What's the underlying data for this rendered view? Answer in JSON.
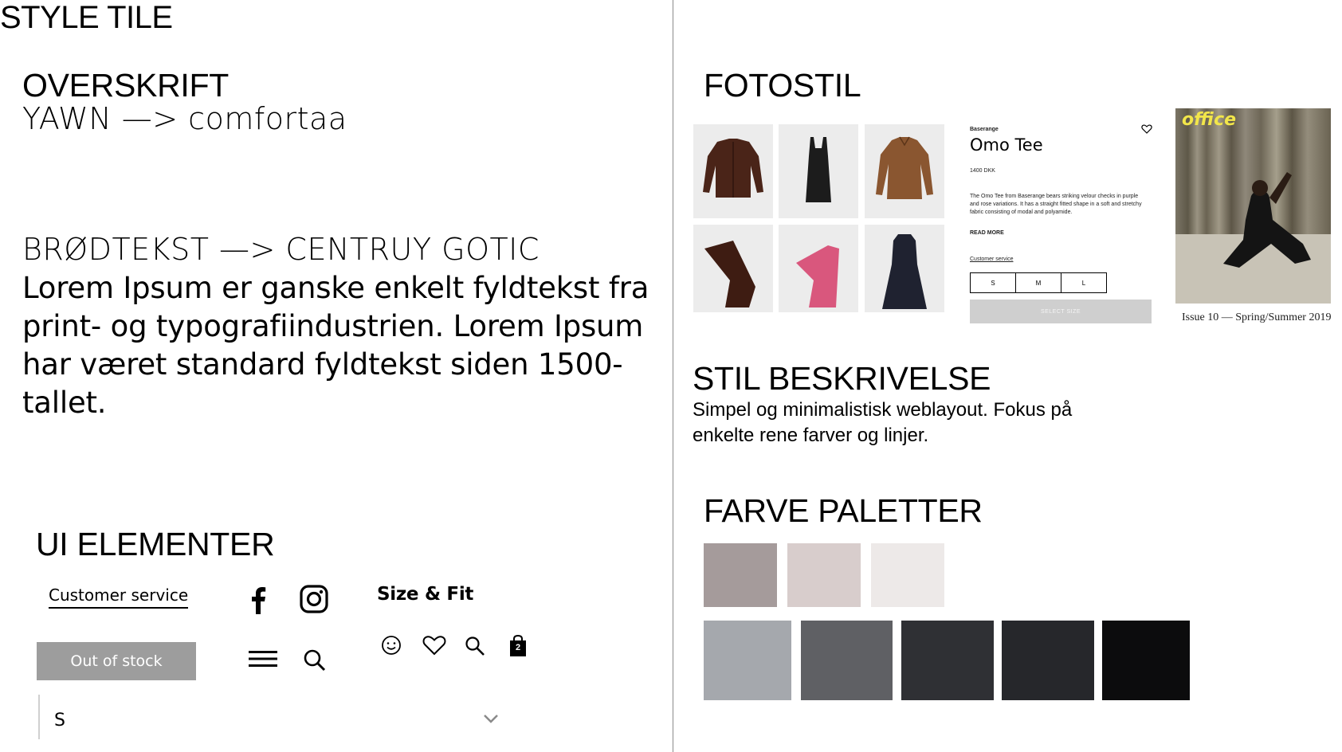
{
  "page_title": "STYLE TILE",
  "headline_section": {
    "heading": "OVERSKRIFT",
    "font_note": "YAWN —> comfortaa"
  },
  "body_section": {
    "heading": "BRØDTEKST —> CENTRUY GOTIC",
    "sample_text": "Lorem Ipsum er ganske enkelt fyldtekst fra print- og typografiindustrien. Lorem Ipsum har været standard fyldtekst siden 1500-tallet."
  },
  "ui_section": {
    "heading": "UI ELEMENTER",
    "customer_service_link": "Customer service",
    "out_of_stock_button": "Out of stock",
    "size_fit_label": "Size & Fit",
    "select_value": "S",
    "bag_count": "2",
    "icons": [
      "facebook-icon",
      "instagram-icon",
      "menu-icon",
      "search-icon",
      "smiley-icon",
      "heart-icon",
      "search-icon",
      "bag-icon",
      "chevron-down-icon"
    ]
  },
  "photo_section": {
    "heading": "FOTOSTIL",
    "product_card": {
      "brand": "Baserange",
      "name": "Omo Tee",
      "price": "1400 DKK",
      "description": "The Omo Tee from Baserange bears striking velour checks in purple and rose variations. It has a straight fitted shape in a soft and stretchy fabric consisting of modal and polyamide.",
      "read_more": "READ MORE",
      "customer_service": "Customer service",
      "sizes": [
        "S",
        "M",
        "L"
      ],
      "select_size": "SELECT SIZE"
    },
    "magazine": {
      "logo": "office",
      "caption": "Issue 10 — Spring/Summer 2019"
    }
  },
  "style_section": {
    "heading": "STIL BESKRIVELSE",
    "text": "Simpel og minimalistisk weblayout. Fokus på enkelte rene farver og linjer."
  },
  "palette_section": {
    "heading": "FARVE PALETTER",
    "row1": [
      "#a59b9b",
      "#d8cdcc",
      "#ede9e8"
    ],
    "row2": [
      "#a5a8ad",
      "#5f6064",
      "#2f3034",
      "#26272b",
      "#0c0c0d"
    ]
  }
}
